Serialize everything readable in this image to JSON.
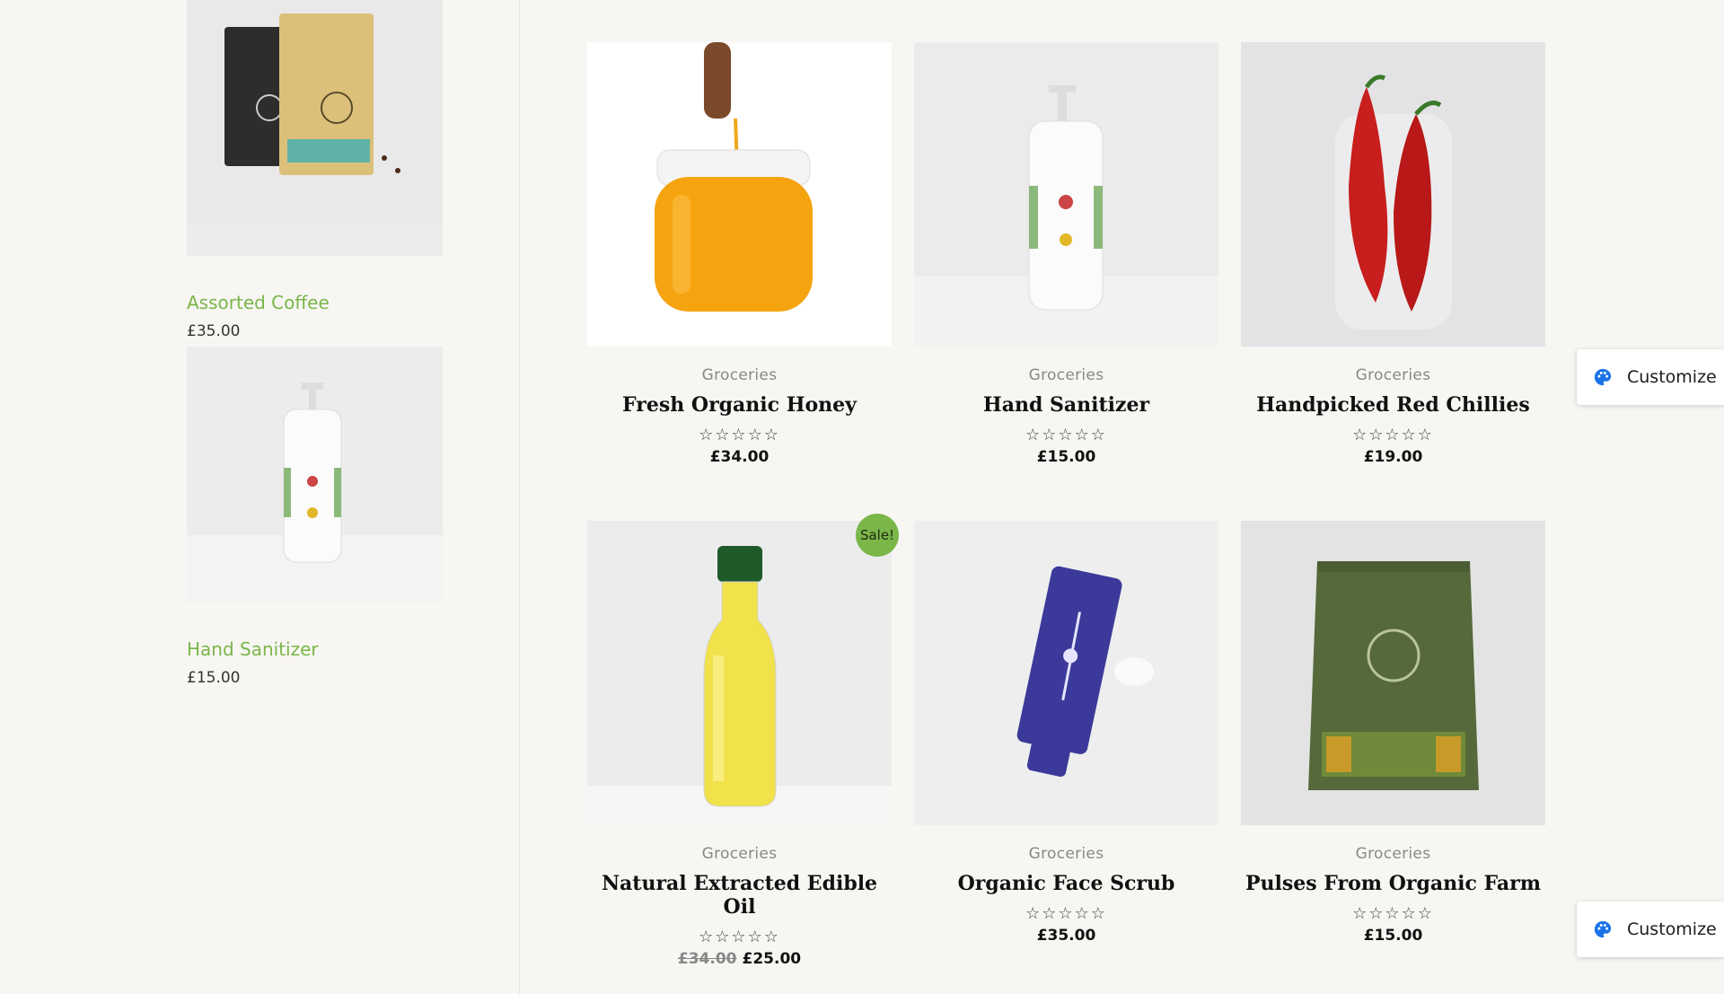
{
  "sidebar": {
    "items": [
      {
        "title": "Assorted Coffee",
        "price": "£35.00",
        "image_icon": "coffee-bag-icon"
      },
      {
        "title": "Hand Sanitizer",
        "price": "£15.00",
        "image_icon": "sanitizer-bottle-icon"
      }
    ]
  },
  "products": [
    {
      "category": "Groceries",
      "title": "Fresh Organic Honey",
      "stars": "☆☆☆☆☆",
      "price": "£34.00",
      "image_icon": "honey-jar-icon"
    },
    {
      "category": "Groceries",
      "title": "Hand Sanitizer",
      "stars": "☆☆☆☆☆",
      "price": "£15.00",
      "image_icon": "sanitizer-bottle-icon"
    },
    {
      "category": "Groceries",
      "title": "Handpicked Red Chillies",
      "stars": "☆☆☆☆☆",
      "price": "£19.00",
      "image_icon": "red-chilli-icon"
    },
    {
      "category": "Groceries",
      "title": "Natural Extracted Edible Oil",
      "stars": "☆☆☆☆☆",
      "old_price": "£34.00",
      "price": "£25.00",
      "image_icon": "oil-bottle-icon"
    },
    {
      "category": "Groceries",
      "title": "Organic Face Scrub",
      "stars": "☆☆☆☆☆",
      "price": "£35.00",
      "image_icon": "face-scrub-tube-icon"
    },
    {
      "category": "Groceries",
      "title": "Pulses From Organic Farm",
      "stars": "☆☆☆☆☆",
      "price": "£15.00",
      "image_icon": "pulses-bag-icon"
    }
  ],
  "sale_badge": "Sale!",
  "customize_label": "Customize",
  "colors": {
    "accent": "#7ab648",
    "background": "#f7f6f3"
  }
}
